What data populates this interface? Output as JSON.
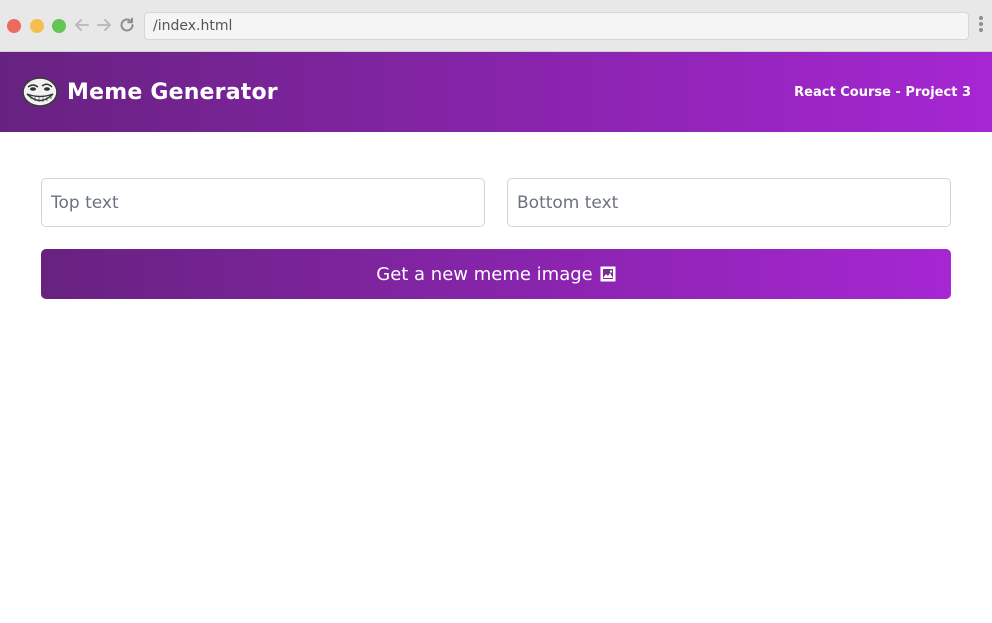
{
  "browser": {
    "url": "/index.html",
    "colors": {
      "close": "#ed6a5e",
      "minimize": "#f5bf4f",
      "maximize": "#62c554"
    },
    "icons": {
      "back": "arrow-left-icon",
      "forward": "arrow-right-icon",
      "reload": "reload-icon",
      "menu": "kebab-menu-icon"
    }
  },
  "header": {
    "title": "Meme Generator",
    "subtitle": "React Course - Project 3",
    "logo_icon": "troll-face-icon",
    "gradient_start": "#672280",
    "gradient_end": "#a626d3"
  },
  "form": {
    "top_text_placeholder": "Top text",
    "bottom_text_placeholder": "Bottom text",
    "top_text_value": "",
    "bottom_text_value": "",
    "button_label": "Get a new meme image",
    "button_icon": "framed-picture-icon",
    "button_gradient_start": "#672280",
    "button_gradient_end": "#a626d3"
  }
}
